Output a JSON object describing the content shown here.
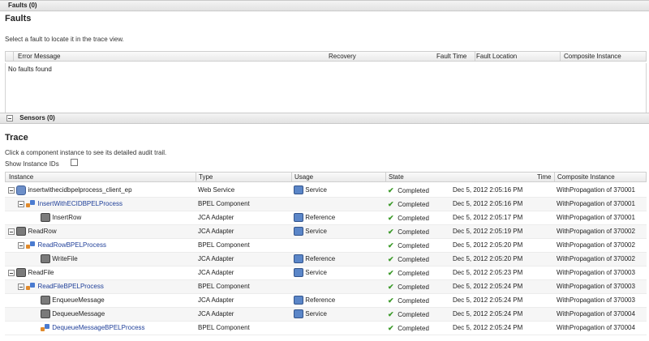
{
  "faults_bar": {
    "label": "Faults (0)"
  },
  "faults": {
    "title": "Faults",
    "hint": "Select a fault to locate it in the trace view.",
    "columns": [
      "Error Message",
      "Recovery",
      "Fault Time",
      "Fault Location",
      "Composite Instance"
    ],
    "empty_text": "No faults found"
  },
  "sensors_bar": {
    "label": "Sensors (0)"
  },
  "trace": {
    "title": "Trace",
    "hint": "Click a component instance to see its detailed audit trail.",
    "show_ids_label": "Show Instance IDs",
    "columns": [
      "Instance",
      "Type",
      "Usage",
      "State",
      "Time",
      "Composite Instance"
    ],
    "rows": [
      {
        "instance": "insertwithecidbpelprocess_client_ep",
        "type": "Web Service",
        "usage": "Service",
        "state": "Completed",
        "time": "Dec 5, 2012 2:05:16 PM",
        "composite": "WithPropagation of 370001"
      },
      {
        "instance": "InsertWithECIDBPELProcess",
        "type": "BPEL Component",
        "usage": "",
        "state": "Completed",
        "time": "Dec 5, 2012 2:05:16 PM",
        "composite": "WithPropagation of 370001"
      },
      {
        "instance": "InsertRow",
        "type": "JCA Adapter",
        "usage": "Reference",
        "state": "Completed",
        "time": "Dec 5, 2012 2:05:17 PM",
        "composite": "WithPropagation of 370001"
      },
      {
        "instance": "ReadRow",
        "type": "JCA Adapter",
        "usage": "Service",
        "state": "Completed",
        "time": "Dec 5, 2012 2:05:19 PM",
        "composite": "WithPropagation of 370002"
      },
      {
        "instance": "ReadRowBPELProcess",
        "type": "BPEL Component",
        "usage": "",
        "state": "Completed",
        "time": "Dec 5, 2012 2:05:20 PM",
        "composite": "WithPropagation of 370002"
      },
      {
        "instance": "WriteFile",
        "type": "JCA Adapter",
        "usage": "Reference",
        "state": "Completed",
        "time": "Dec 5, 2012 2:05:20 PM",
        "composite": "WithPropagation of 370002"
      },
      {
        "instance": "ReadFile",
        "type": "JCA Adapter",
        "usage": "Service",
        "state": "Completed",
        "time": "Dec 5, 2012 2:05:23 PM",
        "composite": "WithPropagation of 370003"
      },
      {
        "instance": "ReadFileBPELProcess",
        "type": "BPEL Component",
        "usage": "",
        "state": "Completed",
        "time": "Dec 5, 2012 2:05:24 PM",
        "composite": "WithPropagation of 370003"
      },
      {
        "instance": "EnqueueMessage",
        "type": "JCA Adapter",
        "usage": "Reference",
        "state": "Completed",
        "time": "Dec 5, 2012 2:05:24 PM",
        "composite": "WithPropagation of 370003"
      },
      {
        "instance": "DequeueMessage",
        "type": "JCA Adapter",
        "usage": "Service",
        "state": "Completed",
        "time": "Dec 5, 2012 2:05:24 PM",
        "composite": "WithPropagation of 370004"
      },
      {
        "instance": "DequeueMessageBPELProcess",
        "type": "BPEL Component",
        "usage": "",
        "state": "Completed",
        "time": "Dec 5, 2012 2:05:24 PM",
        "composite": "WithPropagation of 370004"
      }
    ]
  },
  "colors": {
    "link": "#1f3f99",
    "completed": "#3c9a2a"
  }
}
